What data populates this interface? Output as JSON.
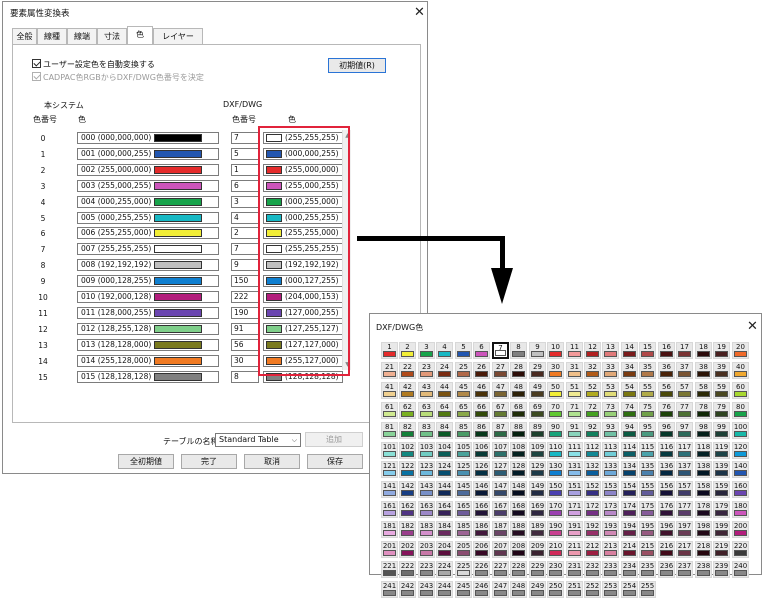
{
  "dialog_main": {
    "title": "要素属性変換表",
    "tabs": [
      "全般",
      "線種",
      "線端",
      "寸法",
      "色",
      "レイヤー"
    ],
    "active_tab": "色",
    "checkbox_auto": {
      "label": "ユーザー設定色を自動変換する",
      "checked": true
    },
    "checkbox_rgb": {
      "label": "CADPAC色RGBからDXF/DWG色番号を決定",
      "checked": true,
      "disabled": true
    },
    "btn_reset": "初期値(R)",
    "left_section": "本システム",
    "left_col_num": "色番号",
    "left_col_color": "色",
    "right_section": "DXF/DWG",
    "right_col_num": "色番号",
    "right_col_color": "色",
    "rows": [
      {
        "idx": "0",
        "value": "000 (000,000,000)",
        "swatch": "#000000",
        "dxf": "7",
        "dxf_rgb": "(255,255,255)",
        "dxf_swatch": "#ffffff"
      },
      {
        "idx": "1",
        "value": "001 (000,000,255)",
        "swatch": "#2256b0",
        "dxf": "5",
        "dxf_rgb": "(000,000,255)",
        "dxf_swatch": "#2256b0"
      },
      {
        "idx": "2",
        "value": "002 (255,000,000)",
        "swatch": "#e42b2b",
        "dxf": "1",
        "dxf_rgb": "(255,000,000)",
        "dxf_swatch": "#e42b2b"
      },
      {
        "idx": "3",
        "value": "003 (255,000,255)",
        "swatch": "#cc55bb",
        "dxf": "6",
        "dxf_rgb": "(255,000,255)",
        "dxf_swatch": "#cc55bb"
      },
      {
        "idx": "4",
        "value": "004 (000,255,000)",
        "swatch": "#17a34a",
        "dxf": "3",
        "dxf_rgb": "(000,255,000)",
        "dxf_swatch": "#17a34a"
      },
      {
        "idx": "5",
        "value": "005 (000,255,255)",
        "swatch": "#17b8c4",
        "dxf": "4",
        "dxf_rgb": "(000,255,255)",
        "dxf_swatch": "#17b8c4"
      },
      {
        "idx": "6",
        "value": "006 (255,255,000)",
        "swatch": "#f2ee36",
        "dxf": "2",
        "dxf_rgb": "(255,255,000)",
        "dxf_swatch": "#f2ee36"
      },
      {
        "idx": "7",
        "value": "007 (255,255,255)",
        "swatch": "#ffffff",
        "dxf": "7",
        "dxf_rgb": "(255,255,255)",
        "dxf_swatch": "#ffffff"
      },
      {
        "idx": "8",
        "value": "008 (192,192,192)",
        "swatch": "#c0c0c0",
        "dxf": "9",
        "dxf_rgb": "(192,192,192)",
        "dxf_swatch": "#c0c0c0"
      },
      {
        "idx": "9",
        "value": "009 (000,128,255)",
        "swatch": "#0f7fd0",
        "dxf": "150",
        "dxf_rgb": "(000,127,255)",
        "dxf_swatch": "#0f7fd0"
      },
      {
        "idx": "10",
        "value": "010 (192,000,128)",
        "swatch": "#b21d7c",
        "dxf": "222",
        "dxf_rgb": "(204,000,153)",
        "dxf_swatch": "#b21d7c"
      },
      {
        "idx": "11",
        "value": "011 (128,000,255)",
        "swatch": "#6a45b0",
        "dxf": "190",
        "dxf_rgb": "(127,000,255)",
        "dxf_swatch": "#6a45b0"
      },
      {
        "idx": "12",
        "value": "012 (128,255,128)",
        "swatch": "#7fcf8a",
        "dxf": "91",
        "dxf_rgb": "(127,255,127)",
        "dxf_swatch": "#7fcf8a"
      },
      {
        "idx": "13",
        "value": "013 (128,128,000)",
        "swatch": "#7a7a1e",
        "dxf": "56",
        "dxf_rgb": "(127,127,000)",
        "dxf_swatch": "#7a7a1e"
      },
      {
        "idx": "14",
        "value": "014 (255,128,000)",
        "swatch": "#f07a22",
        "dxf": "30",
        "dxf_rgb": "(255,127,000)",
        "dxf_swatch": "#f07a22"
      },
      {
        "idx": "15",
        "value": "015 (128,128,128)",
        "swatch": "#808080",
        "dxf": "8",
        "dxf_rgb": "(128,128,128)",
        "dxf_swatch": "#808080"
      }
    ],
    "table_name_label": "テーブルの名称",
    "table_name_value": "Standard Table",
    "btn_add": "追加",
    "btn_all_reset": "全初期値",
    "btn_done": "完了",
    "btn_cancel": "取消",
    "btn_save": "保存",
    "highlight_color": "#e1233b"
  },
  "dialog_palette": {
    "title": "DXF/DWG色",
    "selected": 7,
    "colors": [
      "#e42b2b",
      "#f2ee36",
      "#17a34a",
      "#17b8c4",
      "#2256b0",
      "#cc55bb",
      "#ffffff",
      "#808080",
      "#c0c0c0",
      "#e42b2b",
      "#f39a9a",
      "#b02020",
      "#e07a7a",
      "#7a1a1a",
      "#b04848",
      "#4a1010",
      "#7a3232",
      "#2c0a0a",
      "#4a2020",
      "#f06a2a",
      "#f0b092",
      "#b04a1a",
      "#e09878",
      "#7a2a10",
      "#b06848",
      "#4a1a08",
      "#7a4832",
      "#2c0c06",
      "#4a2a20",
      "#f07a22",
      "#f0c08a",
      "#b05a18",
      "#e0a878",
      "#7a3a10",
      "#b07848",
      "#4a2208",
      "#7a5432",
      "#2c1406",
      "#4a3020",
      "#f0a830",
      "#f0d090",
      "#b07a20",
      "#e0b878",
      "#7a5210",
      "#b08848",
      "#4a3208",
      "#7a6432",
      "#2c2006",
      "#4a3c20",
      "#f2ee36",
      "#f0ea92",
      "#b0aa20",
      "#e0dc78",
      "#7a7610",
      "#b0aa48",
      "#4a4808",
      "#7a7632",
      "#2c2a06",
      "#4a4820",
      "#a8d830",
      "#d0ea90",
      "#7ab020",
      "#b8dc78",
      "#527a10",
      "#8aa848",
      "#324a08",
      "#647a32",
      "#1e2c06",
      "#3c4a20",
      "#60c830",
      "#b0e290",
      "#44a020",
      "#98d078",
      "#2e6e10",
      "#70a048",
      "#1c4208",
      "#4c7032",
      "#102806",
      "#2e4420",
      "#17a34a",
      "#8ad49a",
      "#128038",
      "#70c088",
      "#0a5a26",
      "#4a9a66",
      "#06381a",
      "#2c6a46",
      "#04200e",
      "#1c402c",
      "#17a37a",
      "#8ad4bc",
      "#12805e",
      "#70c0a4",
      "#0a5a42",
      "#4a9a80",
      "#06382a",
      "#2c6a5a",
      "#04201a",
      "#1c4036",
      "#17b8a8",
      "#8ae0d6",
      "#128880",
      "#70ccc2",
      "#0a5e58",
      "#4aa29a",
      "#063a36",
      "#2c706a",
      "#042220",
      "#1c4440",
      "#17b8c4",
      "#8ae0e6",
      "#128894",
      "#70ccd6",
      "#0a5e66",
      "#4aa2aa",
      "#063a40",
      "#2c7078",
      "#042226",
      "#1c4448",
      "#0f9ad8",
      "#86cdec",
      "#0a72a2",
      "#6cb8dc",
      "#064e70",
      "#4a90b0",
      "#043044",
      "#2c5c74",
      "#021c28",
      "#1c3a48",
      "#0f7fd0",
      "#86bcea",
      "#0a5e9c",
      "#6ca8d8",
      "#06426c",
      "#4a80ac",
      "#042842",
      "#2c5474",
      "#021826",
      "#1c3448",
      "#2256b0",
      "#90aae0",
      "#183e84",
      "#7890c8",
      "#102a5a",
      "#4c6a9a",
      "#0a1a38",
      "#34486a",
      "#060e20",
      "#222c44",
      "#4a40b0",
      "#a8a0e0",
      "#363084",
      "#8c84c8",
      "#24205a",
      "#625c9a",
      "#161238",
      "#403c6a",
      "#0c0a20",
      "#28263c",
      "#6a45b0",
      "#b8a2e0",
      "#503484",
      "#9c88c8",
      "#36225a",
      "#6e5c9a",
      "#221438",
      "#4a3c6a",
      "#140a20",
      "#2e2640",
      "#9a40b0",
      "#d0a0e0",
      "#743084",
      "#b888c8",
      "#4e205a",
      "#865c9a",
      "#301238",
      "#5a3c6a",
      "#1c0a20",
      "#382640",
      "#cc55bb",
      "#e8aae0",
      "#9a3e8c",
      "#d490cc",
      "#6a2a60",
      "#9c6494",
      "#42183c",
      "#6a4466",
      "#260c22",
      "#402a3e",
      "#c84090",
      "#e8a0c8",
      "#963068",
      "#d088b4",
      "#662048",
      "#965a80",
      "#40122c",
      "#6a3c56",
      "#240a18",
      "#402636",
      "#b21d7c",
      "#e090c0",
      "#86145c",
      "#c878a8",
      "#5c0e3e",
      "#8a4c70",
      "#380826",
      "#603650",
      "#200416",
      "#3a2230",
      "#d02a5a",
      "#ec98ae",
      "#9c1e42",
      "#d880a0",
      "#6a142c",
      "#9a5064",
      "#420a1a",
      "#6a3446",
      "#26060e",
      "#402028",
      "#3a3a3a",
      "#545454",
      "#6e6e6e",
      "#888888",
      "#a8a8a8",
      "#d8d8d8"
    ]
  }
}
